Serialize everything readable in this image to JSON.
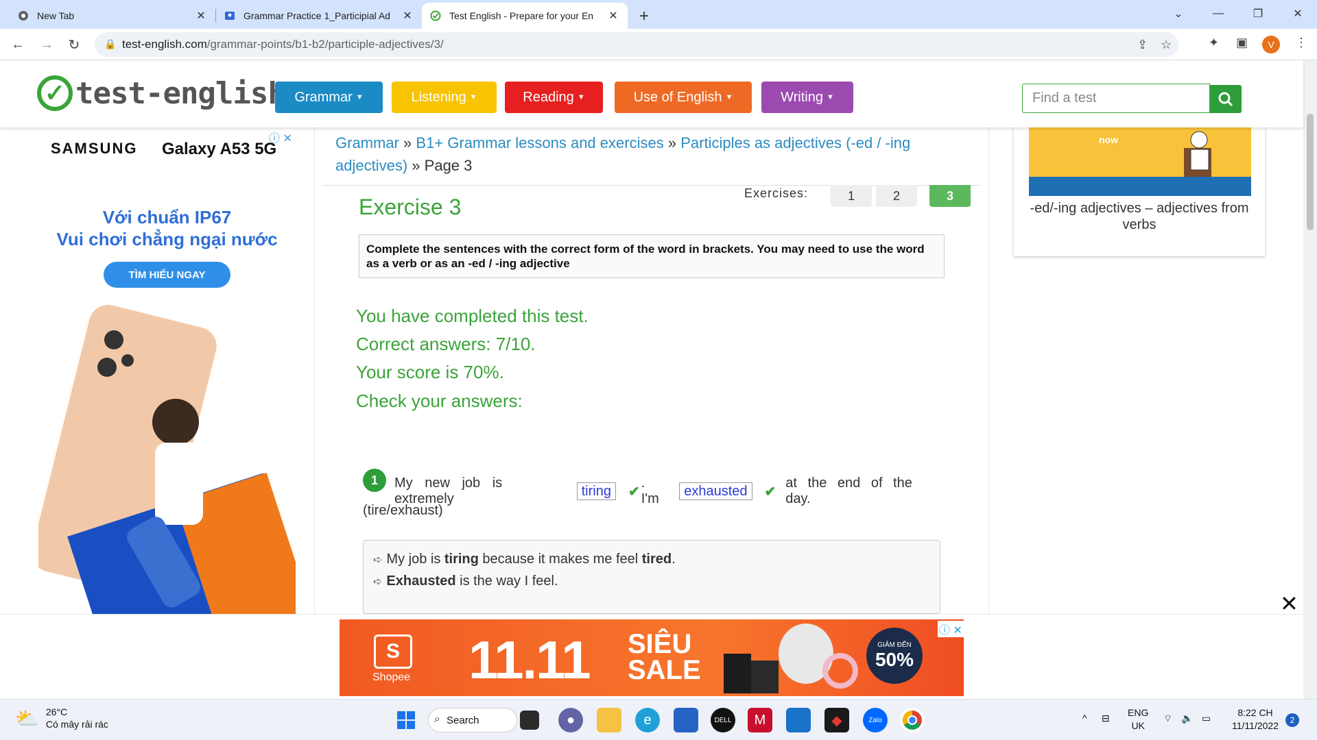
{
  "browser": {
    "tabs": [
      {
        "title": "New Tab",
        "favicon": "chrome-icon"
      },
      {
        "title": "Grammar Practice 1_Participial Ad",
        "favicon": "classroom-icon"
      },
      {
        "title": "Test English - Prepare for your En",
        "favicon": "test-english-icon"
      }
    ],
    "url_domain": "test-english.com",
    "url_path": "/grammar-points/b1-b2/participle-adjectives/3/",
    "profile_initial": "V"
  },
  "site": {
    "logo_text": "test-english",
    "menu": [
      {
        "label": "Grammar",
        "color": "#1b8bc5"
      },
      {
        "label": "Listening",
        "color": "#f8c300"
      },
      {
        "label": "Reading",
        "color": "#e62020"
      },
      {
        "label": "Use of English",
        "color": "#ee6a24"
      },
      {
        "label": "Writing",
        "color": "#9b4bb0"
      }
    ],
    "search_placeholder": "Find a test"
  },
  "left_ad": {
    "brand": "SAMSUNG",
    "model": "Galaxy A53 5G",
    "line1": "Với chuẩn IP67",
    "line2": "Vui chơi chẳng ngại nước",
    "cta": "TÌM HIỂU NGAY"
  },
  "breadcrumb": {
    "items": [
      "Grammar",
      "B1+ Grammar lessons and exercises",
      "Participles as adjectives (-ed / -ing adjectives)"
    ],
    "current": "Page 3",
    "separator": "»"
  },
  "exercise": {
    "title": "Exercise 3",
    "nav_label": "Exercises:",
    "nav_numbers": [
      "1",
      "2",
      "3"
    ],
    "active": "3",
    "instructions": "Complete the sentences with the correct form of the word in brackets. You may need to use the word as a verb or as an -ed / -ing adjective",
    "results": [
      "You have completed this test.",
      "Correct answers: 7/10.",
      "Your score is 70%.",
      "Check your answers:"
    ],
    "question": {
      "number": "1",
      "part1": "My new job is extremely",
      "answer1": "tiring",
      "part2": ". I'm",
      "answer2": "exhausted",
      "part3": "at the end of the day.",
      "hint": "(tire/exhaust)",
      "explanation": {
        "line1_a": "My job is ",
        "line1_b": "tiring",
        "line1_c": " because it makes me feel ",
        "line1_d": "tired",
        "line1_e": ".",
        "line2_a": "Exhausted",
        "line2_b": " is the way I feel."
      }
    }
  },
  "right_card": {
    "thumb_word": "now",
    "caption": "-ed/-ing adjectives – adjectives from verbs"
  },
  "bottom_ad": {
    "brand": "Shopee",
    "sale_number": "11.11",
    "sale_word1": "SIÊU",
    "sale_word2": "SALE",
    "discount_small": "GIẢM ĐẾN",
    "discount_big": "50%"
  },
  "taskbar": {
    "temperature": "26°C",
    "weather": "Có mây rải rác",
    "search_label": "Search",
    "lang1": "ENG",
    "lang2": "UK",
    "time": "8:22 CH",
    "date": "11/11/2022",
    "notifications": "2"
  }
}
